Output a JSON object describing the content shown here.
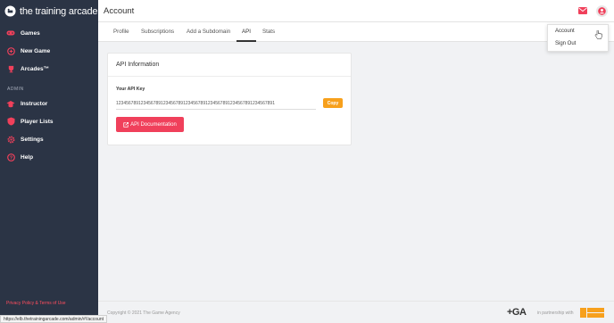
{
  "brand": {
    "name": "the training arcade",
    "logo_icon": "game-controller-icon"
  },
  "sidebar": {
    "items": [
      {
        "label": "Games",
        "icon": "gamepad-icon"
      },
      {
        "label": "New Game",
        "icon": "plus-circle-icon"
      },
      {
        "label": "Arcades™",
        "icon": "trophy-icon"
      }
    ],
    "admin_label": "ADMIN",
    "admin_items": [
      {
        "label": "Instructor",
        "icon": "graduation-cap-icon"
      },
      {
        "label": "Player Lists",
        "icon": "shield-icon"
      },
      {
        "label": "Settings",
        "icon": "gear-icon"
      },
      {
        "label": "Help",
        "icon": "question-circle-icon"
      }
    ],
    "privacy_link": "Privacy Policy & Terms of Use"
  },
  "header": {
    "title": "Account",
    "mail_icon": "mail-icon",
    "user_icon": "user-circle-icon"
  },
  "tabs": [
    {
      "label": "Profile",
      "active": false
    },
    {
      "label": "Subscriptions",
      "active": false
    },
    {
      "label": "Add a Subdomain",
      "active": false
    },
    {
      "label": "API",
      "active": true
    },
    {
      "label": "Stats",
      "active": false
    }
  ],
  "user_menu": {
    "items": [
      "Account",
      "Sign Out"
    ]
  },
  "api_card": {
    "title": "API Information",
    "key_label": "Your API Key",
    "key_value": "1234567891234567891234567891234567891234567891234567891234567891",
    "copy_label": "Copy",
    "doc_button": "API Documentation"
  },
  "footer": {
    "copyright": "Copyright © 2021 The Game Agency",
    "tga_logo": "+GA",
    "partner_text": "in partnership with"
  },
  "status_bar_url": "https://elb.thetrainingarcade.com/admin/#!/account",
  "colors": {
    "sidebar_bg": "#2b3445",
    "accent_red": "#f0405b",
    "copy_orange": "#f7a01c",
    "privacy_link": "#ff4d5e"
  }
}
